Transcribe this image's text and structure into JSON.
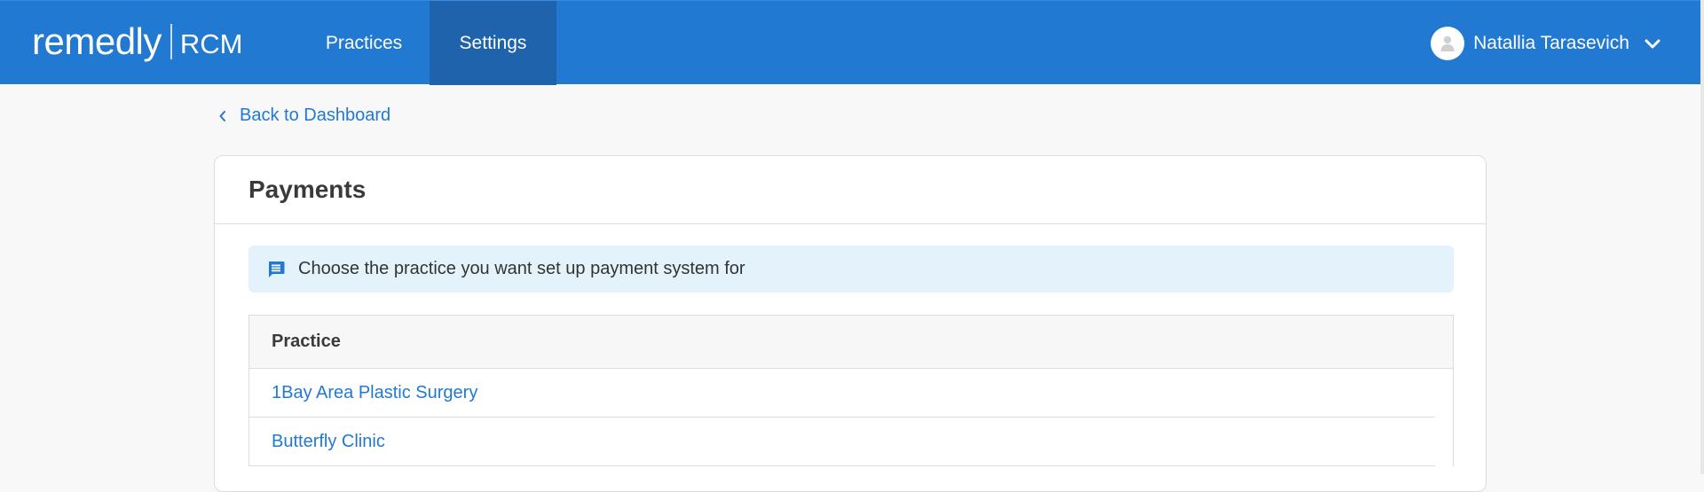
{
  "header": {
    "brand_name": "remedly",
    "brand_suffix": "RCM",
    "nav": [
      {
        "label": "Practices",
        "active": false
      },
      {
        "label": "Settings",
        "active": true
      }
    ],
    "user_name": "Natallia Tarasevich",
    "colors": {
      "bar": "#2179d2",
      "active_tab": "#1e63ab"
    }
  },
  "back_link": {
    "label": "Back to Dashboard"
  },
  "card": {
    "title": "Payments",
    "info_message": "Choose the practice you want set up payment system for",
    "table": {
      "header": "Practice",
      "rows": [
        {
          "label": "1Bay Area Plastic Surgery"
        },
        {
          "label": "Butterfly Clinic"
        }
      ]
    }
  },
  "icons": {
    "back": "chevron-left-icon",
    "info": "message-icon",
    "user": "user-avatar-icon",
    "menu": "chevron-down-icon"
  }
}
